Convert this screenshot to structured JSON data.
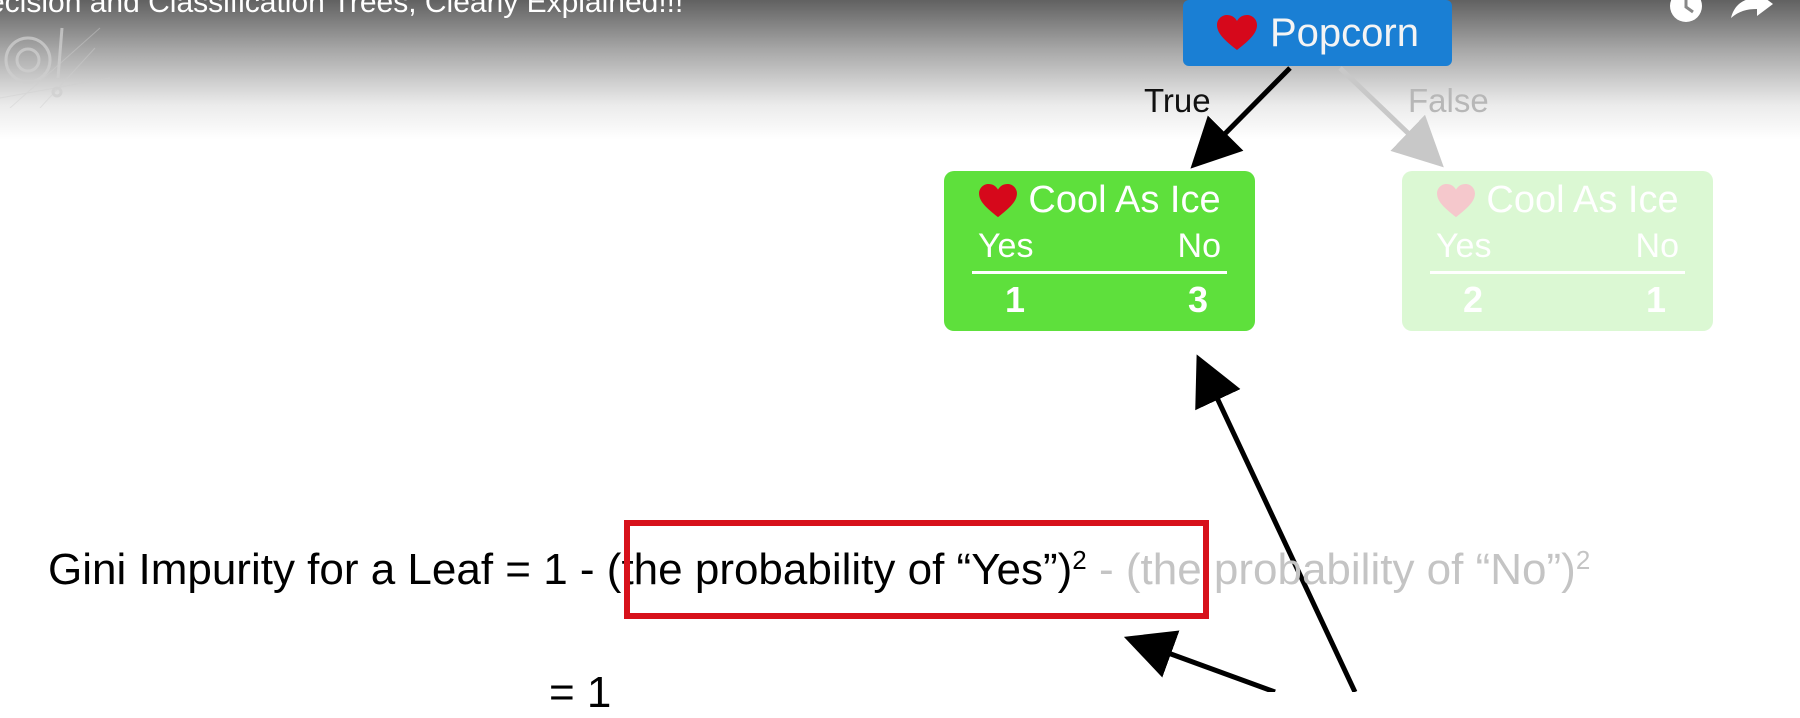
{
  "video": {
    "title": "ecision and Classification Trees, Clearly Explained!!!"
  },
  "icons": {
    "channel_logo": "statquest-logo",
    "watch_later": "clock-icon",
    "share": "share-icon",
    "heart": "heart-icon"
  },
  "colors": {
    "root_node": "#1a7fd4",
    "leaf_node": "#5ee03c",
    "highlight": "#d7111b"
  },
  "tree": {
    "root": {
      "label": "Popcorn"
    },
    "branches": {
      "true_label": "True",
      "false_label": "False"
    },
    "leaf_true": {
      "title": "Cool As Ice",
      "col_yes": "Yes",
      "col_no": "No",
      "yes_value": "1",
      "no_value": "3"
    },
    "leaf_false": {
      "title": "Cool As Ice",
      "col_yes": "Yes",
      "col_no": "No",
      "yes_value": "2",
      "no_value": "1"
    }
  },
  "formula": {
    "left": "Gini Impurity for a Leaf = 1 ",
    "yes_term": "- (the probability of “Yes”)",
    "exponent": "2",
    "no_term": " - (the probability of “No”)",
    "no_exponent": "2",
    "next_line": "= 1"
  }
}
